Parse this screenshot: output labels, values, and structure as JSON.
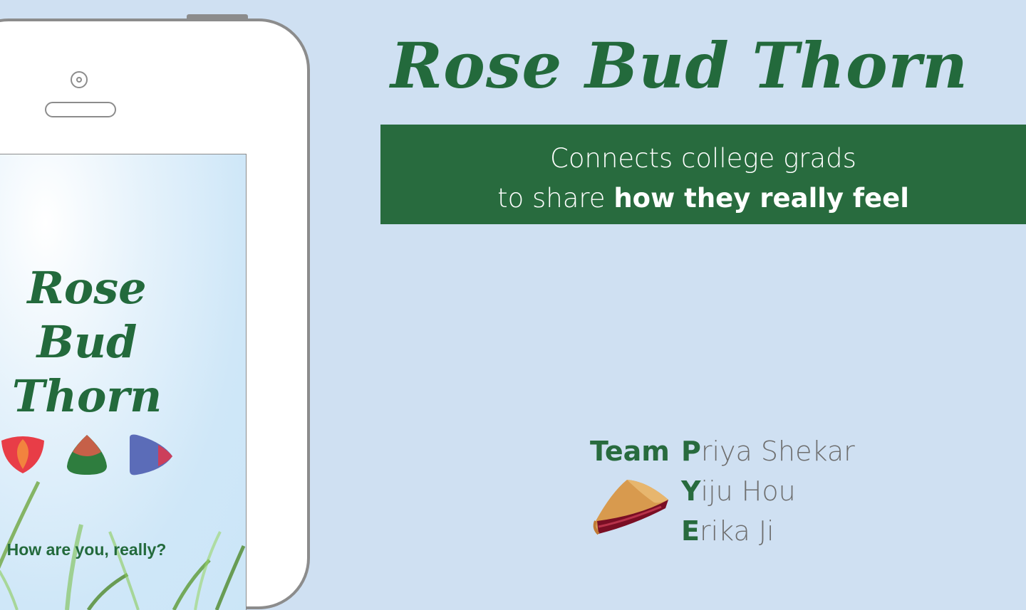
{
  "app": {
    "title": "Rose Bud Thorn",
    "tagline_line1": "Connects college grads",
    "tagline_line2_prefix": "to share ",
    "tagline_line2_bold": "how they really feel"
  },
  "phone_screen": {
    "title_lines": [
      "Rose",
      "Bud",
      "Thorn"
    ],
    "question": "How are you, really?",
    "icons": [
      "rose-icon",
      "bud-icon",
      "thorn-icon"
    ]
  },
  "team": {
    "label": "Team",
    "members": [
      {
        "initial": "P",
        "rest": "riya Shekar"
      },
      {
        "initial": "Y",
        "rest": "iju Hou"
      },
      {
        "initial": "E",
        "rest": "rika Ji"
      }
    ],
    "logo_icon": "pie-icon"
  },
  "colors": {
    "background": "#cfe0f2",
    "brand_green": "#286b3e",
    "rose_red": "#e8333d",
    "bud_green": "#2e7d3e",
    "thorn_blue": "#5b6cb8"
  }
}
